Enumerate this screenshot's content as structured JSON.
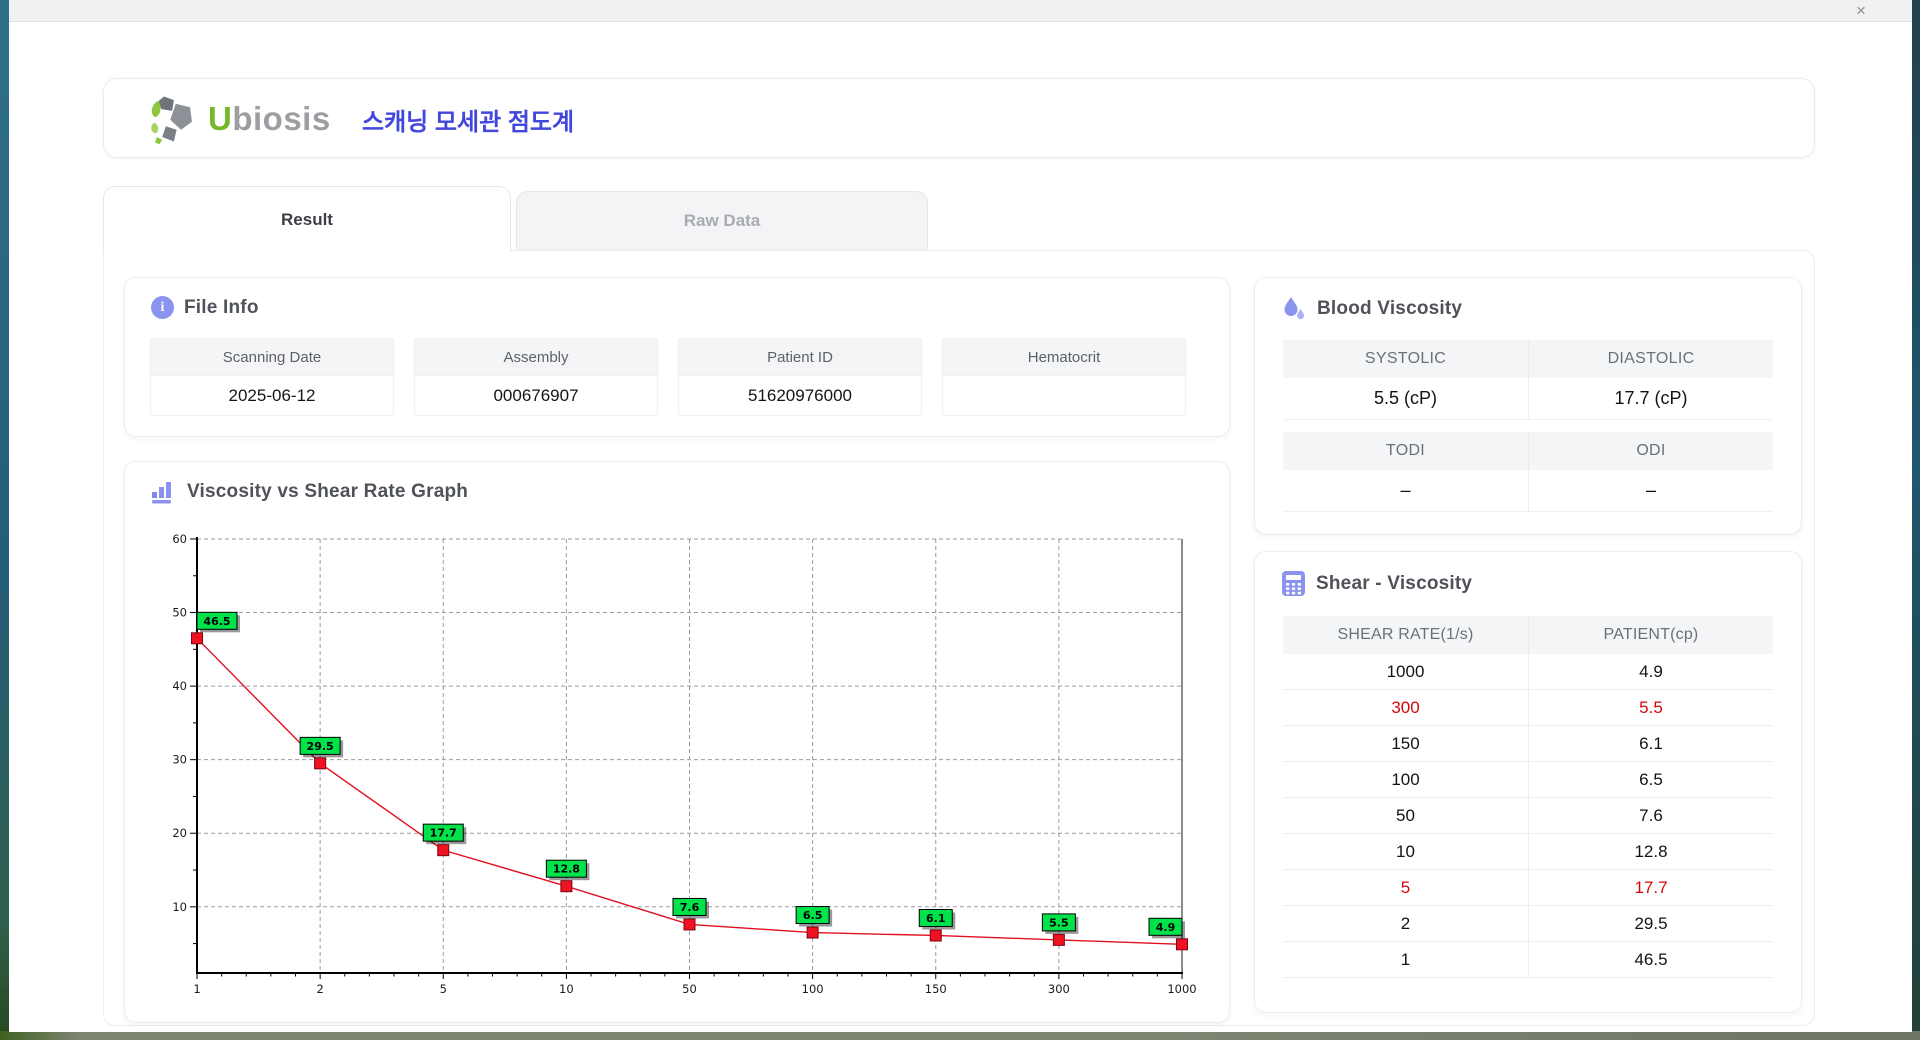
{
  "window": {
    "close_glyph": "×"
  },
  "header": {
    "brand_first_letter": "U",
    "brand_rest": "biosis",
    "title": "스캐닝 모세관 점도계"
  },
  "tabs": [
    {
      "label": "Result",
      "active": true
    },
    {
      "label": "Raw Data",
      "active": false
    }
  ],
  "file_info": {
    "title": "File Info",
    "icon_glyph": "i",
    "fields": [
      {
        "label": "Scanning Date",
        "value": "2025-06-12"
      },
      {
        "label": "Assembly",
        "value": "000676907"
      },
      {
        "label": "Patient ID",
        "value": "51620976000"
      },
      {
        "label": "Hematocrit",
        "value": ""
      }
    ]
  },
  "blood_viscosity": {
    "title": "Blood Viscosity",
    "groups": [
      {
        "headers": [
          "SYSTOLIC",
          "DIASTOLIC"
        ],
        "values": [
          "5.5 (cP)",
          "17.7 (cP)"
        ]
      },
      {
        "headers": [
          "TODI",
          "ODI"
        ],
        "values": [
          "–",
          "–"
        ]
      }
    ]
  },
  "shear_viscosity": {
    "title": "Shear - Viscosity",
    "columns": [
      "SHEAR RATE(1/s)",
      "PATIENT(cp)"
    ],
    "rows": [
      {
        "shear": "1000",
        "patient": "4.9",
        "highlight": false
      },
      {
        "shear": "300",
        "patient": "5.5",
        "highlight": true
      },
      {
        "shear": "150",
        "patient": "6.1",
        "highlight": false
      },
      {
        "shear": "100",
        "patient": "6.5",
        "highlight": false
      },
      {
        "shear": "50",
        "patient": "7.6",
        "highlight": false
      },
      {
        "shear": "10",
        "patient": "12.8",
        "highlight": false
      },
      {
        "shear": "5",
        "patient": "17.7",
        "highlight": true
      },
      {
        "shear": "2",
        "patient": "29.5",
        "highlight": false
      },
      {
        "shear": "1",
        "patient": "46.5",
        "highlight": false
      }
    ],
    "highlight_color": "#d40808"
  },
  "chart_data": {
    "type": "line",
    "title": "Viscosity vs Shear Rate Graph",
    "x_categories": [
      "1",
      "2",
      "5",
      "10",
      "50",
      "100",
      "150",
      "300",
      "1000"
    ],
    "values": [
      46.5,
      29.5,
      17.7,
      12.8,
      7.6,
      6.5,
      6.1,
      5.5,
      4.9
    ],
    "point_labels": [
      "46.5",
      "29.5",
      "17.7",
      "12.8",
      "7.6",
      "6.5",
      "6.1",
      "5.5",
      "4.9"
    ],
    "y_ticks": [
      10,
      20,
      30,
      40,
      50,
      60
    ],
    "ylim": [
      1,
      60
    ],
    "x_spacing": "categorical-even",
    "grid": "dashed",
    "line_color": "#e0101f",
    "marker_color": "#ee1222",
    "marker_border": "#7d0511",
    "label_bg": "#00e24a",
    "label_border": "#000000",
    "label_text": "#000000"
  }
}
